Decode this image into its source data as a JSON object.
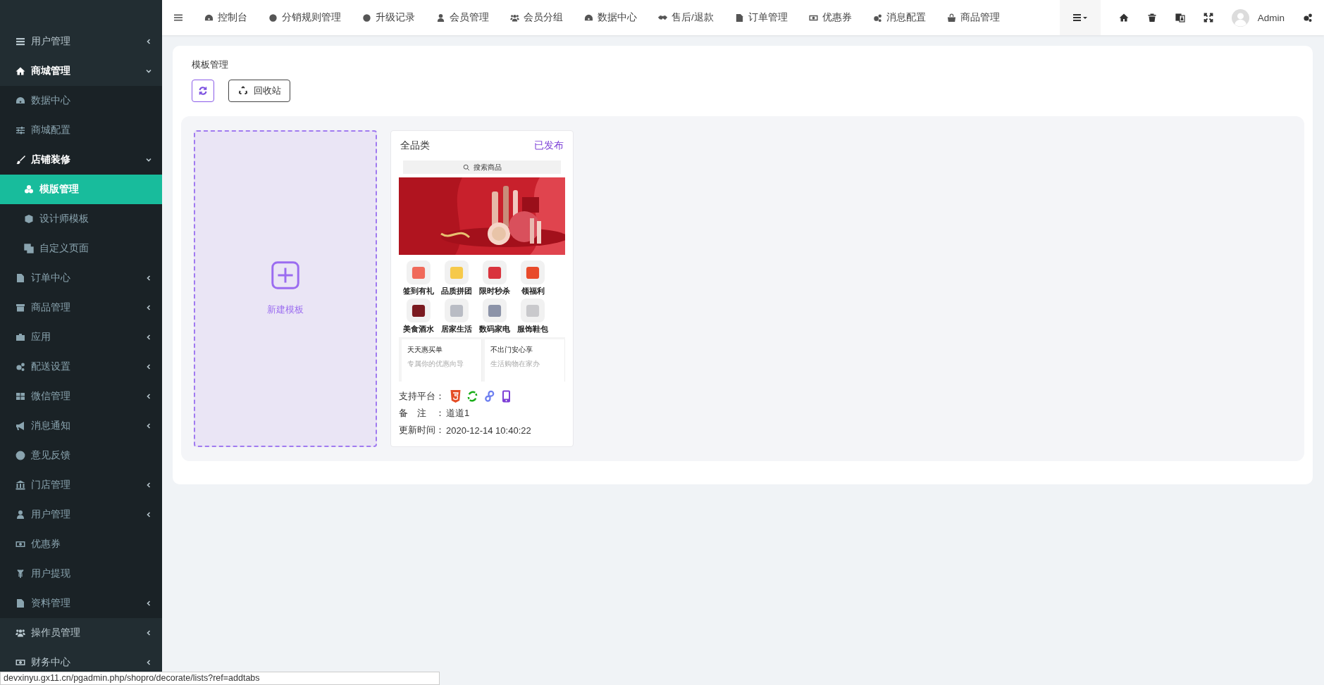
{
  "sidebar": {
    "items": [
      {
        "label": "用户管理",
        "expanded": false,
        "selected": false
      },
      {
        "label": "商城管理",
        "expanded": true,
        "selected": false,
        "children": [
          {
            "label": "数据中心",
            "selected": false
          },
          {
            "label": "商城配置",
            "selected": false
          },
          {
            "label": "店铺装修",
            "expanded": true,
            "selected": false,
            "children": [
              {
                "label": "模版管理",
                "selected": true
              },
              {
                "label": "设计师模板",
                "selected": false
              },
              {
                "label": "自定义页面",
                "selected": false
              }
            ]
          },
          {
            "label": "订单中心",
            "expanded": false,
            "selected": false
          },
          {
            "label": "商品管理",
            "expanded": false,
            "selected": false
          },
          {
            "label": "应用",
            "expanded": false,
            "selected": false
          },
          {
            "label": "配送设置",
            "expanded": false,
            "selected": false
          },
          {
            "label": "微信管理",
            "expanded": false,
            "selected": false
          },
          {
            "label": "消息通知",
            "expanded": false,
            "selected": false
          },
          {
            "label": "意见反馈",
            "selected": false
          },
          {
            "label": "门店管理",
            "expanded": false,
            "selected": false
          },
          {
            "label": "用户管理",
            "expanded": false,
            "selected": false
          },
          {
            "label": "优惠券",
            "selected": false
          },
          {
            "label": "用户提现",
            "selected": false
          },
          {
            "label": "资料管理",
            "expanded": false,
            "selected": false
          }
        ]
      },
      {
        "label": "操作员管理",
        "expanded": false,
        "selected": false
      },
      {
        "label": "财务中心",
        "expanded": false,
        "selected": false
      }
    ]
  },
  "top_nav": {
    "tabs": [
      "控制台",
      "分销规则管理",
      "升级记录",
      "会员管理",
      "会员分组",
      "数据中心",
      "售后/退款",
      "订单管理",
      "优惠券",
      "消息配置",
      "商品管理"
    ],
    "user": "Admin"
  },
  "panel": {
    "title": "模板管理",
    "recycle_button": "回收站",
    "new_template": "新建模板",
    "templates": [
      {
        "name": "全品类",
        "status": "已发布",
        "preview": {
          "search": "搜索商品",
          "categories": [
            "签到有礼",
            "品质拼团",
            "限时秒杀",
            "领福利",
            "美食酒水",
            "居家生活",
            "数码家电",
            "服饰鞋包"
          ],
          "promos": [
            {
              "title": "天天惠买单",
              "subtitle": "专属你的优惠向导"
            },
            {
              "title": "不出门安心享",
              "subtitle": "生活购物在家办"
            }
          ]
        },
        "platforms_label": "支持平台：",
        "note_label": "备　注　：",
        "note": "道道1",
        "updated_label": "更新时间：",
        "updated": "2020-12-14 10:40:22"
      }
    ]
  },
  "status_bar": {
    "url": "devxinyu.gx11.cn/pgadmin.php/shopro/decorate/lists?ref=addtabs"
  }
}
